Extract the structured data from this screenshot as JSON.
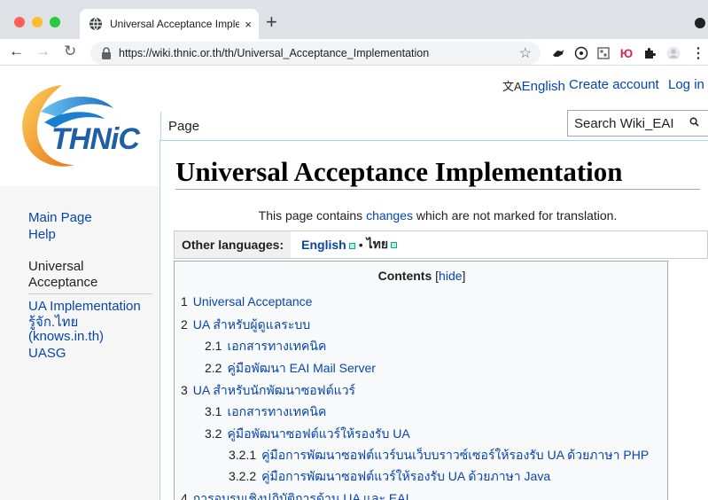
{
  "browser": {
    "tab_title": "Universal Acceptance Impleme",
    "tab_close": "×",
    "new_tab": "+",
    "url": "https://wiki.thnic.or.th/th/Universal_Acceptance_Implementation"
  },
  "site": {
    "logo_text": "THNiC"
  },
  "header": {
    "language_link": "English",
    "create_account": "Create account",
    "log_in": "Log in",
    "tab_page": "Page",
    "search_placeholder": "Search Wiki_EAI"
  },
  "sidebar": {
    "main_page": "Main Page",
    "help": "Help",
    "section_title_1": "Universal",
    "section_title_2": "Acceptance",
    "ua_implementation": "UA Implementation",
    "knows_1": "รู้จัก.ไทย",
    "knows_2": "(knows.in.th)",
    "uasg": "UASG"
  },
  "content": {
    "title": "Universal Acceptance Implementation",
    "notice_before": "This page contains ",
    "notice_link": "changes",
    "notice_after": " which are not marked for translation.",
    "other_languages_label": "Other languages:",
    "lang_english": "English",
    "lang_separator": "•",
    "lang_thai": "ไทย"
  },
  "toc": {
    "title": "Contents",
    "hide_open": "[",
    "hide_label": "hide",
    "hide_close": "]",
    "items": [
      {
        "num": "1",
        "text": "Universal Acceptance"
      },
      {
        "num": "2",
        "text": "UA สำหรับผู้ดูแลระบบ"
      },
      {
        "num": "2.1",
        "text": "เอกสารทางเทคนิค"
      },
      {
        "num": "2.2",
        "text": "คู่มือพัฒนา EAI Mail Server"
      },
      {
        "num": "3",
        "text": "UA สำหรับนักพัฒนาซอฟต์แวร์"
      },
      {
        "num": "3.1",
        "text": "เอกสารทางเทคนิค"
      },
      {
        "num": "3.2",
        "text": "คู่มือพัฒนาซอฟต์แวร์ให้รองรับ UA"
      },
      {
        "num": "3.2.1",
        "text": "คู่มือการพัฒนาซอฟต์แวร์บนเว็บบราวซ์เซอร์ให้รองรับ UA ด้วยภาษา PHP"
      },
      {
        "num": "3.2.2",
        "text": "คู่มือการพัฒนาซอฟต์แวร์ให้รองรับ UA ด้วยภาษา Java"
      },
      {
        "num": "4",
        "text": "การอบรมเชิงปฏิบัติการด้าน UA และ EAI"
      }
    ]
  },
  "colors": {
    "link": "#0645ad",
    "text": "#202122",
    "sidebar_bg": "#f6f6f6",
    "tab_border": "#a7d7f9",
    "logo_orange": "#f39c1e",
    "logo_blue": "#1a7fd0"
  }
}
